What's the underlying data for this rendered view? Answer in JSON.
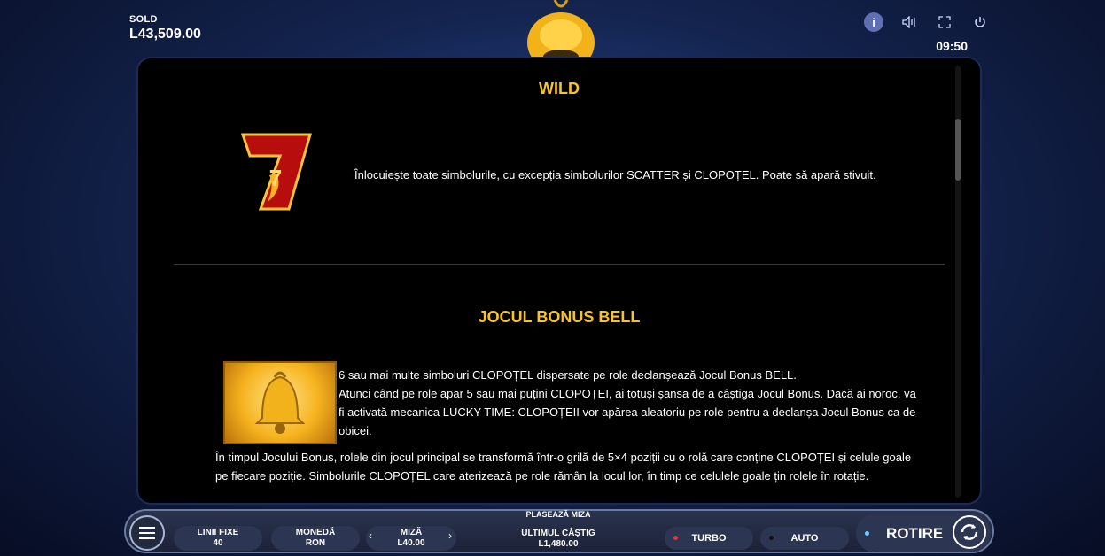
{
  "balance": {
    "label": "SOLD",
    "value": "L43,509.00"
  },
  "clock": "09:50",
  "top_icons": [
    "info-icon",
    "sound-icon",
    "fullscreen-icon",
    "power-icon"
  ],
  "info_glyph": "i",
  "wild": {
    "title": "WILD",
    "text": "Înlocuiește toate simbolurile, cu excepția simbolurilor SCATTER și CLOPOȚEL. Poate să apară stivuit.",
    "symbol": "7"
  },
  "bonus": {
    "title": "JOCUL BONUS BELL",
    "line1": "6 sau mai multe simboluri CLOPOȚEL dispersate pe role declanșează Jocul Bonus BELL.",
    "line2": "Atunci când pe role apar 5 sau mai puțini CLOPOȚEI, ai totuși șansa de a câștiga Jocul Bonus. Dacă ai noroc, va fi activată mecanica LUCKY TIME: CLOPOȚEII vor apărea aleatoriu pe role pentru a declanșa Jocul Bonus ca de obicei.",
    "line3": "În timpul Jocului Bonus, rolele din jocul principal se transformă într-o grilă de 5×4 poziții cu o rolă care conține CLOPOȚEI și celule goale pe fiecare poziție. Simbolurile CLOPOȚEL care aterizează pe role rămân la locul lor, în timp ce celulele goale țin rolele în rotație."
  },
  "bottom": {
    "place_bet": "PLASEAZĂ MIZA",
    "lines": {
      "label": "LINII FIXE",
      "value": "40"
    },
    "currency": {
      "label": "MONEDĂ",
      "value": "RON"
    },
    "bet": {
      "label": "MIZĂ",
      "value": "L40.00"
    },
    "last_win": {
      "label": "ULTIMUL CÂȘTIG",
      "value": "L1,480.00"
    },
    "turbo": "TURBO",
    "auto": "AUTO",
    "spin": "ROTIRE"
  },
  "colors": {
    "gold": "#f7c325",
    "turbo_dot": "#e23b3b",
    "auto_dot": "#111111",
    "spin_dot": "#6fd0ff"
  }
}
